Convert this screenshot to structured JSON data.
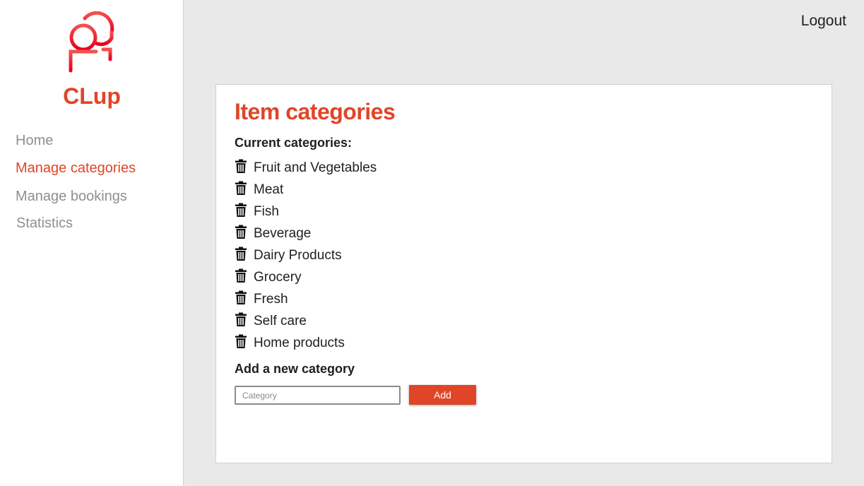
{
  "colors": {
    "accent": "#e04528",
    "logo": "#f01c28",
    "nav_inactive": "#8f8f8f",
    "text": "#1f1f1f"
  },
  "sidebar": {
    "logo_icon": "people-icon",
    "brand": "CLup",
    "nav": [
      {
        "label": "Home",
        "active": false
      },
      {
        "label": "Manage categories",
        "active": true
      },
      {
        "label": "Manage bookings",
        "active": false
      },
      {
        "label": "Statistics",
        "active": false
      }
    ]
  },
  "header": {
    "logout": "Logout"
  },
  "main": {
    "title": "Item categories",
    "current_label": "Current categories:",
    "delete_icon": "trash-icon",
    "categories": [
      "Fruit and Vegetables",
      "Meat",
      "Fish",
      "Beverage",
      "Dairy Products",
      "Grocery",
      "Fresh",
      "Self care",
      "Home products"
    ],
    "add_label": "Add a new category",
    "input": {
      "placeholder": "Category",
      "value": ""
    },
    "add_button": "Add"
  }
}
